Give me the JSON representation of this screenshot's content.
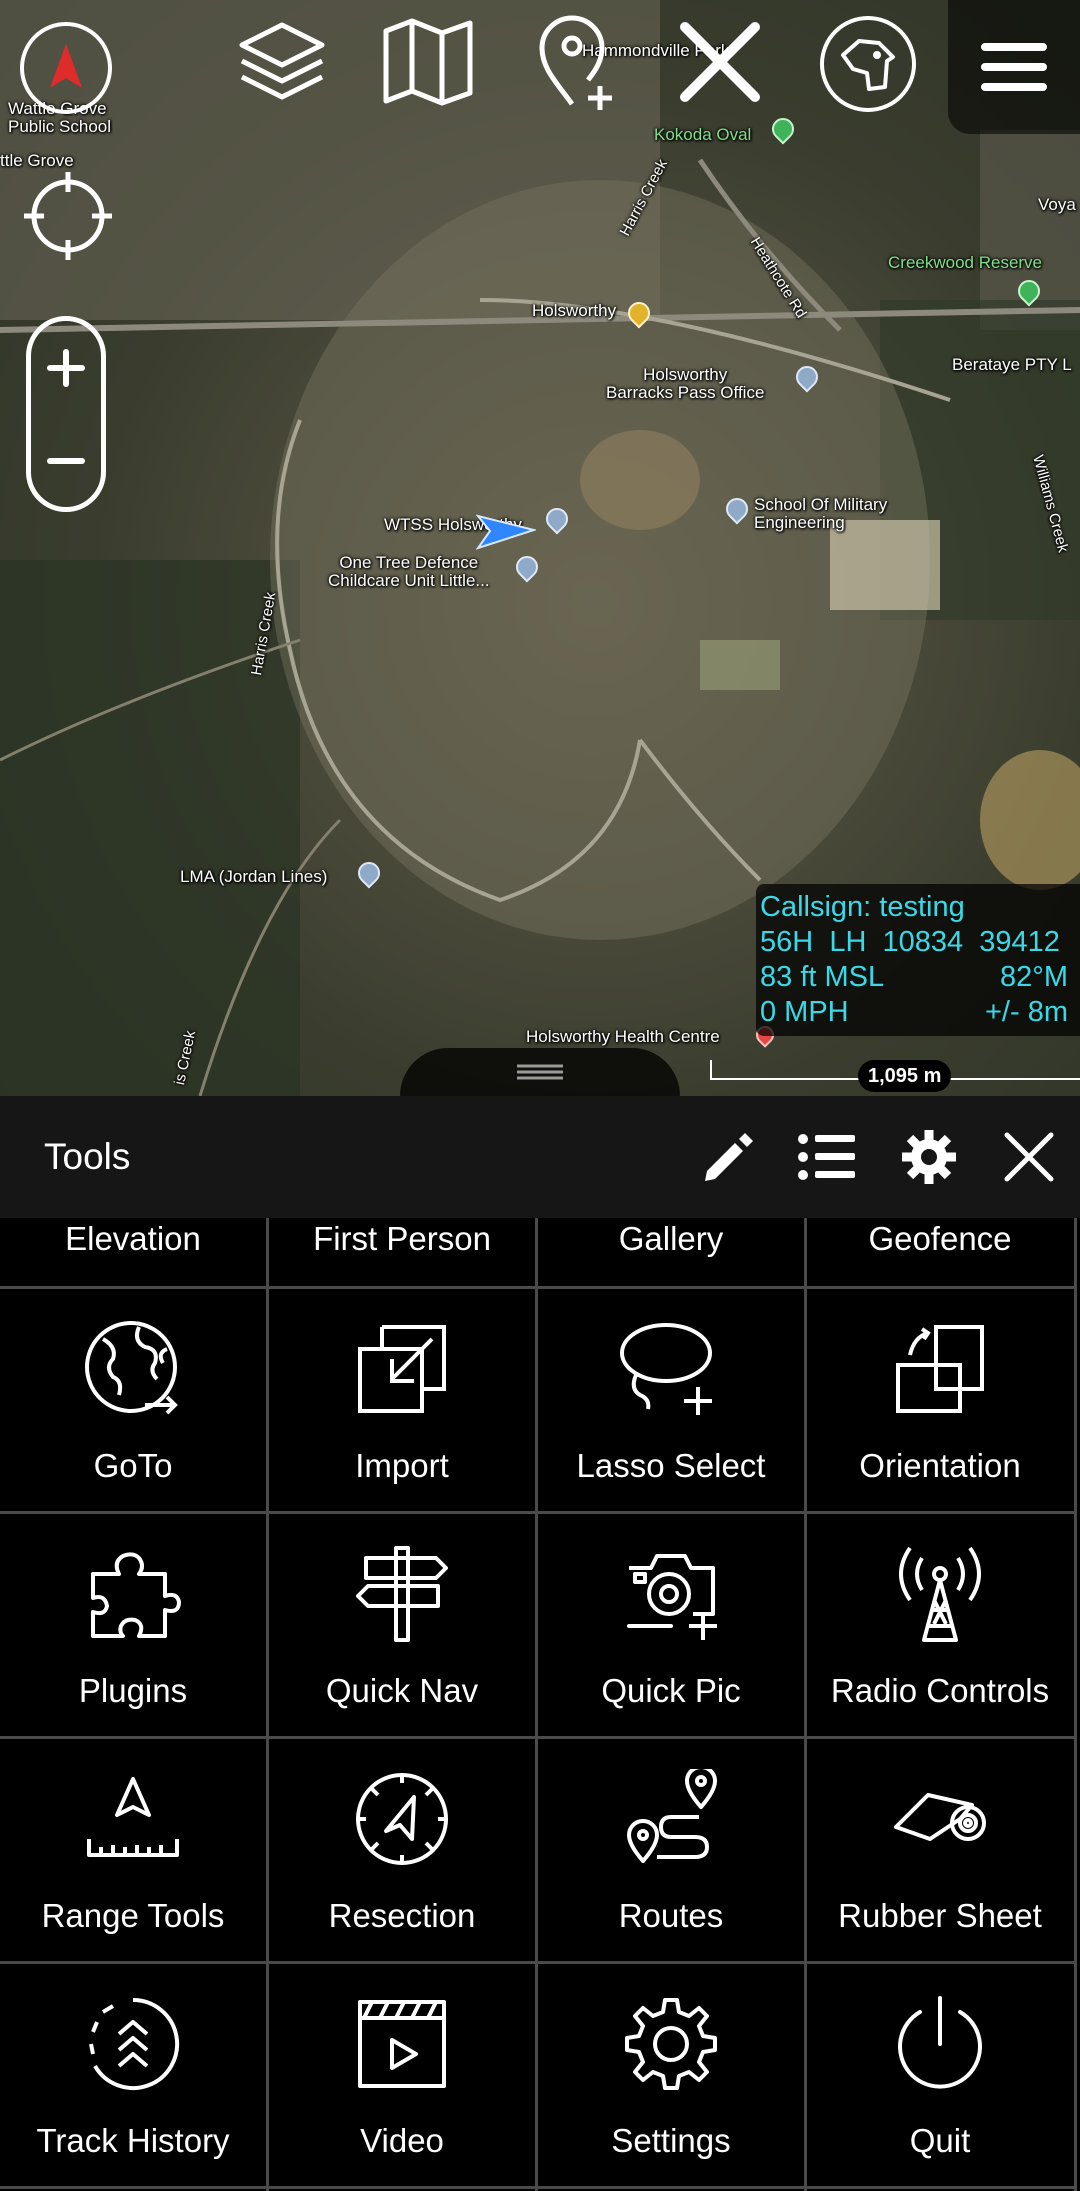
{
  "map": {
    "labels": [
      {
        "text": "Wattle Grove\nPublic School",
        "cls": ""
      },
      {
        "text": "ttle Grove",
        "cls": ""
      },
      {
        "text": "Hammondville Park",
        "cls": ""
      },
      {
        "text": "Kokoda Oval",
        "cls": "green"
      },
      {
        "text": "Harris Creek",
        "cls": ""
      },
      {
        "text": "Heathcote Rd",
        "cls": ""
      },
      {
        "text": "Voya",
        "cls": ""
      },
      {
        "text": "Creekwood Reserve",
        "cls": "green"
      },
      {
        "text": "Holsworthy",
        "cls": ""
      },
      {
        "text": "Berataye PTY L",
        "cls": ""
      },
      {
        "text": "Holsworthy\nBarracks Pass Office",
        "cls": ""
      },
      {
        "text": "School Of Military\nEngineering",
        "cls": ""
      },
      {
        "text": "WTSS Holsworthy",
        "cls": ""
      },
      {
        "text": "One Tree Defence\nChildcare Unit Little...",
        "cls": ""
      },
      {
        "text": "Harris Creek",
        "cls": ""
      },
      {
        "text": "Williams Creek",
        "cls": ""
      },
      {
        "text": "LMA (Jordan Lines)",
        "cls": ""
      },
      {
        "text": "Holsworthy Health Centre",
        "cls": ""
      },
      {
        "text": "is Creek",
        "cls": ""
      }
    ],
    "info": {
      "callsign": "Callsign: testing",
      "grid": "56H  LH  10834  39412",
      "altitude": "83 ft MSL",
      "heading": "82°M",
      "speed": "0 MPH",
      "accuracy": "+/- 8m"
    },
    "scale": "1,095 m"
  },
  "toolbar_icons": [
    "compass-icon",
    "layers-icon",
    "map-icon",
    "add-point-icon",
    "close-icon",
    "dog-icon",
    "menu-icon"
  ],
  "tools": {
    "title": "Tools",
    "partial_row": [
      "Elevation",
      "First Person",
      "Gallery",
      "Geofence"
    ],
    "items": [
      {
        "label": "GoTo",
        "icon": "globe-icon"
      },
      {
        "label": "Import",
        "icon": "import-icon"
      },
      {
        "label": "Lasso Select",
        "icon": "lasso-icon"
      },
      {
        "label": "Orientation",
        "icon": "orientation-icon"
      },
      {
        "label": "Plugins",
        "icon": "puzzle-icon"
      },
      {
        "label": "Quick Nav",
        "icon": "signpost-icon"
      },
      {
        "label": "Quick Pic",
        "icon": "camera-icon"
      },
      {
        "label": "Radio Controls",
        "icon": "radio-tower-icon"
      },
      {
        "label": "Range Tools",
        "icon": "range-ruler-icon"
      },
      {
        "label": "Resection",
        "icon": "resection-compass-icon"
      },
      {
        "label": "Routes",
        "icon": "routes-icon"
      },
      {
        "label": "Rubber Sheet",
        "icon": "rubber-sheet-icon"
      },
      {
        "label": "Track History",
        "icon": "track-history-icon"
      },
      {
        "label": "Video",
        "icon": "video-icon"
      },
      {
        "label": "Settings",
        "icon": "settings-gear-icon"
      },
      {
        "label": "Quit",
        "icon": "power-icon"
      }
    ]
  }
}
